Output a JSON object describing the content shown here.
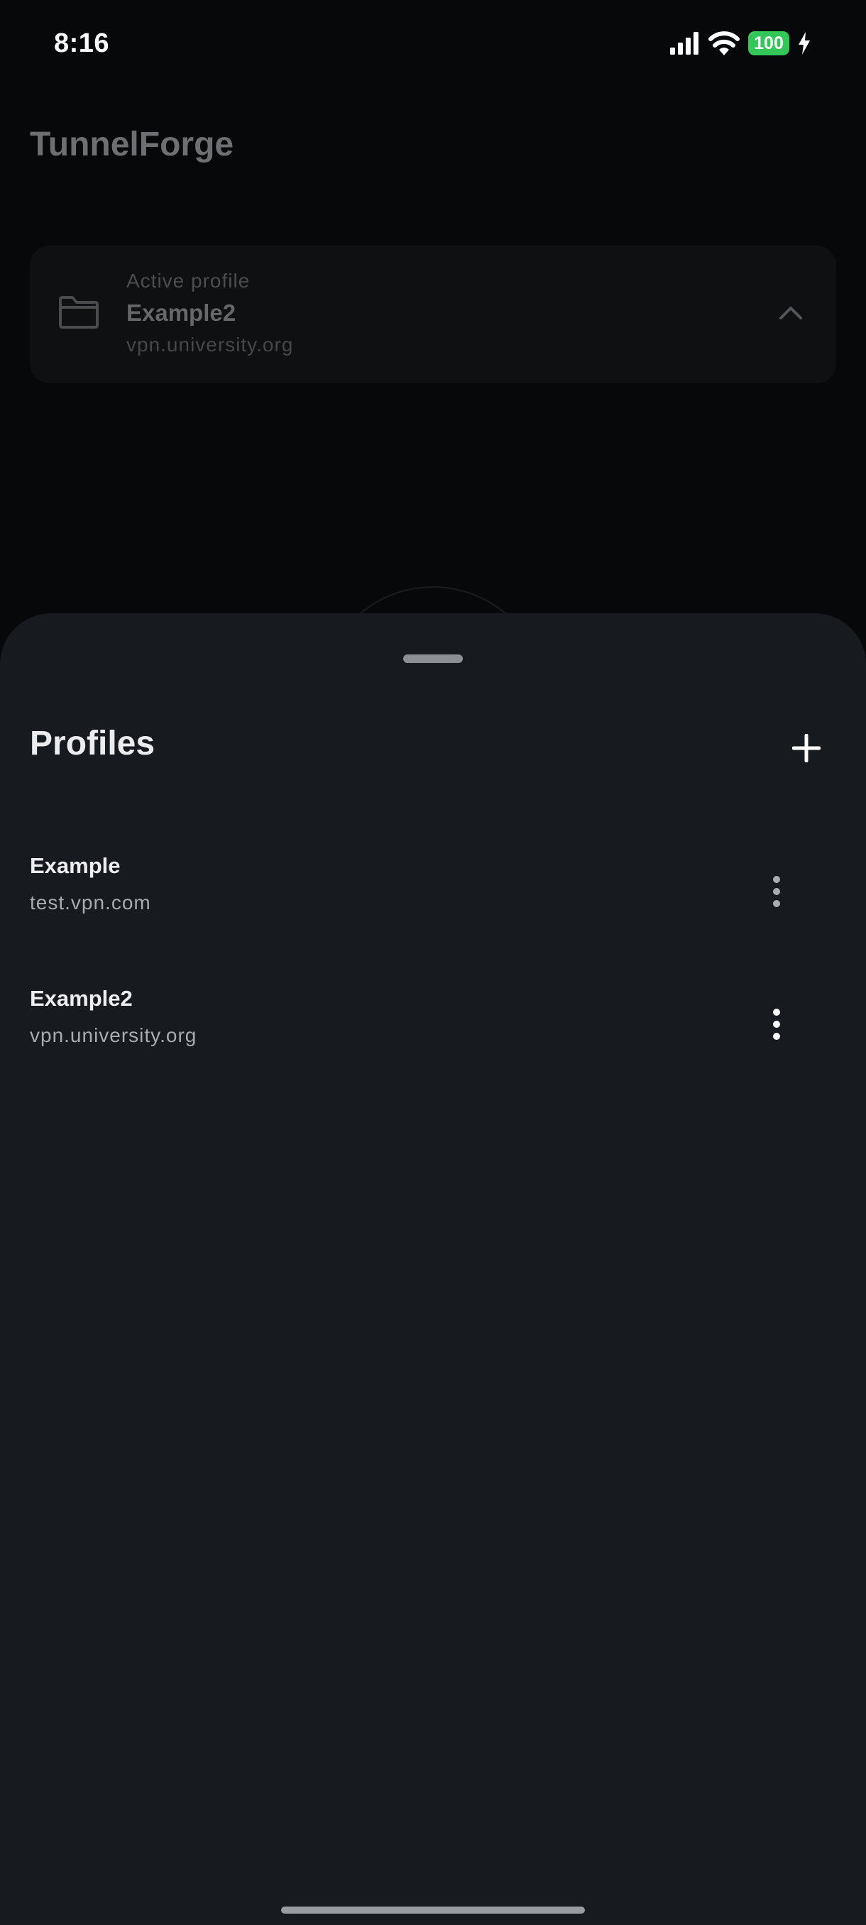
{
  "status_bar": {
    "time": "8:16",
    "battery_level": "100",
    "battery_color": "#33c75a",
    "icons": [
      "signal-icon",
      "wifi-icon",
      "battery-icon",
      "charging-icon"
    ]
  },
  "app": {
    "title": "TunnelForge"
  },
  "active_profile": {
    "label": "Active profile",
    "name": "Example2",
    "host": "vpn.university.org",
    "icons": [
      "folder-icon",
      "chevron-up-icon"
    ]
  },
  "sheet": {
    "title": "Profiles",
    "add_icon": "plus-icon",
    "profiles": [
      {
        "name": "Example",
        "host": "test.vpn.com",
        "menu_icon": "more-vertical-icon"
      },
      {
        "name": "Example2",
        "host": "vpn.university.org",
        "menu_icon": "more-vertical-icon"
      }
    ]
  },
  "colors": {
    "background": "#07080a",
    "sheet": "#171a1f",
    "text_primary": "#eeeef0",
    "text_secondary": "#a8abb0"
  }
}
